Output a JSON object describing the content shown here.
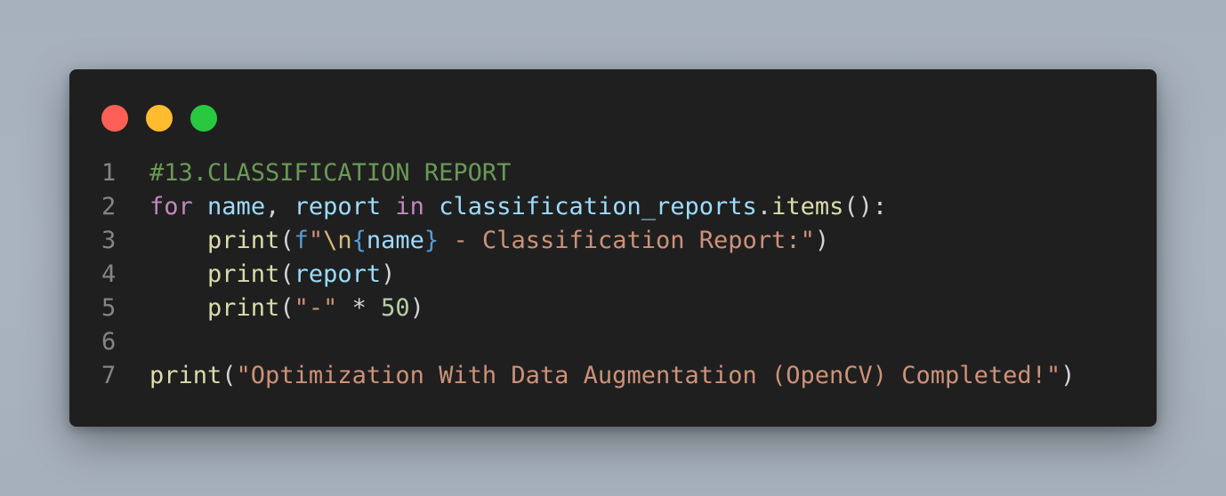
{
  "window": {
    "traffic_lights": [
      {
        "name": "close",
        "color": "#ff5f57"
      },
      {
        "name": "minimize",
        "color": "#febc2e"
      },
      {
        "name": "maximize",
        "color": "#28c840"
      }
    ]
  },
  "code": {
    "language": "python",
    "lines": [
      {
        "number": "1",
        "tokens": [
          {
            "text": "#13.CLASSIFICATION REPORT",
            "kind": "comment"
          }
        ]
      },
      {
        "number": "2",
        "tokens": [
          {
            "text": "for",
            "kind": "kw"
          },
          {
            "text": " ",
            "kind": "punc"
          },
          {
            "text": "name",
            "kind": "var"
          },
          {
            "text": ", ",
            "kind": "punc"
          },
          {
            "text": "report",
            "kind": "var"
          },
          {
            "text": " ",
            "kind": "punc"
          },
          {
            "text": "in",
            "kind": "kw"
          },
          {
            "text": " ",
            "kind": "punc"
          },
          {
            "text": "classification_reports",
            "kind": "var"
          },
          {
            "text": ".",
            "kind": "punc"
          },
          {
            "text": "items",
            "kind": "fn"
          },
          {
            "text": "():",
            "kind": "punc"
          }
        ]
      },
      {
        "number": "3",
        "tokens": [
          {
            "text": "    ",
            "kind": "punc"
          },
          {
            "text": "print",
            "kind": "fn"
          },
          {
            "text": "(",
            "kind": "punc"
          },
          {
            "text": "f",
            "kind": "fprefix"
          },
          {
            "text": "\"",
            "kind": "str"
          },
          {
            "text": "\\n",
            "kind": "esc"
          },
          {
            "text": "{",
            "kind": "brace"
          },
          {
            "text": "name",
            "kind": "var"
          },
          {
            "text": "}",
            "kind": "brace"
          },
          {
            "text": " - Classification Report:\"",
            "kind": "str"
          },
          {
            "text": ")",
            "kind": "punc"
          }
        ]
      },
      {
        "number": "4",
        "tokens": [
          {
            "text": "    ",
            "kind": "punc"
          },
          {
            "text": "print",
            "kind": "fn"
          },
          {
            "text": "(",
            "kind": "punc"
          },
          {
            "text": "report",
            "kind": "var"
          },
          {
            "text": ")",
            "kind": "punc"
          }
        ]
      },
      {
        "number": "5",
        "tokens": [
          {
            "text": "    ",
            "kind": "punc"
          },
          {
            "text": "print",
            "kind": "fn"
          },
          {
            "text": "(",
            "kind": "punc"
          },
          {
            "text": "\"-\"",
            "kind": "str"
          },
          {
            "text": " * ",
            "kind": "punc"
          },
          {
            "text": "50",
            "kind": "num"
          },
          {
            "text": ")",
            "kind": "punc"
          }
        ]
      },
      {
        "number": "6",
        "tokens": []
      },
      {
        "number": "7",
        "tokens": [
          {
            "text": "print",
            "kind": "fn"
          },
          {
            "text": "(",
            "kind": "punc"
          },
          {
            "text": "\"Optimization With Data Augmentation (OpenCV) Completed!\"",
            "kind": "str"
          },
          {
            "text": ")",
            "kind": "punc"
          }
        ]
      }
    ]
  }
}
